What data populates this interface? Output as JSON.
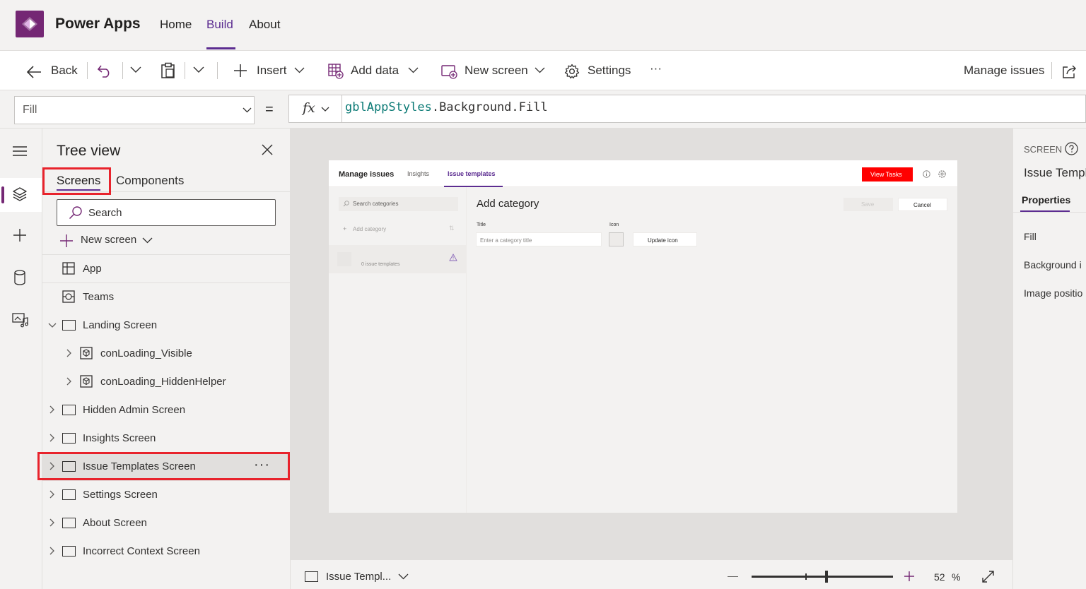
{
  "header": {
    "app_title": "Power Apps",
    "nav": [
      {
        "label": "Home"
      },
      {
        "label": "Build",
        "active": true
      },
      {
        "label": "About"
      }
    ],
    "accent_color": "#742774"
  },
  "toolbar": {
    "back_label": "Back",
    "insert_label": "Insert",
    "add_data_label": "Add data",
    "new_screen_label": "New screen",
    "settings_label": "Settings",
    "more_label": "···",
    "manage_issues_label": "Manage issues"
  },
  "formula_bar": {
    "property": "Fill",
    "equals": "=",
    "fx": "fx",
    "formula_part1": "gblAppStyles",
    "formula_part2": ".Background.Fill"
  },
  "tree_view": {
    "title": "Tree view",
    "tabs": [
      "Screens",
      "Components"
    ],
    "search_placeholder": "Search",
    "new_screen_label": "New screen",
    "items": [
      {
        "label": "App",
        "icon": "app-icon"
      },
      {
        "label": "Teams",
        "icon": "teams-icon"
      },
      {
        "label": "Landing Screen",
        "icon": "screen-icon",
        "expanded": true
      },
      {
        "label": "conLoading_Visible",
        "icon": "component-icon"
      },
      {
        "label": "conLoading_HiddenHelper",
        "icon": "component-icon"
      },
      {
        "label": "Hidden Admin Screen",
        "icon": "screen-icon"
      },
      {
        "label": "Insights Screen",
        "icon": "screen-icon"
      },
      {
        "label": "Issue Templates Screen",
        "icon": "screen-icon",
        "selected": true
      },
      {
        "label": "Settings Screen",
        "icon": "screen-icon"
      },
      {
        "label": "About Screen",
        "icon": "screen-icon"
      },
      {
        "label": "Incorrect Context Screen",
        "icon": "screen-icon"
      }
    ],
    "more_label": "···",
    "highlight_color": "#e8232c"
  },
  "preview": {
    "app_name": "Manage issues",
    "tabs": [
      "Insights",
      "Issue templates"
    ],
    "view_tasks_label": "View Tasks",
    "search_placeholder": "Search categories",
    "add_category_label": "Add category",
    "template_count": "0 issue templates",
    "panel_title": "Add category",
    "save_label": "Save",
    "cancel_label": "Cancel",
    "title_label": "Title",
    "title_placeholder": "Enter a category title",
    "icon_label": "Icon",
    "update_icon_label": "Update icon",
    "view_tasks_color": "#ff0000"
  },
  "status_bar": {
    "screen_name": "Issue Templ...",
    "zoom_value": "52",
    "zoom_unit": "%",
    "zoom_fraction": 0.52
  },
  "right_panel": {
    "section_label": "SCREEN",
    "screen_name": "Issue Templ",
    "tab_label": "Properties",
    "properties": [
      "Fill",
      "Background i",
      "Image positio"
    ]
  }
}
